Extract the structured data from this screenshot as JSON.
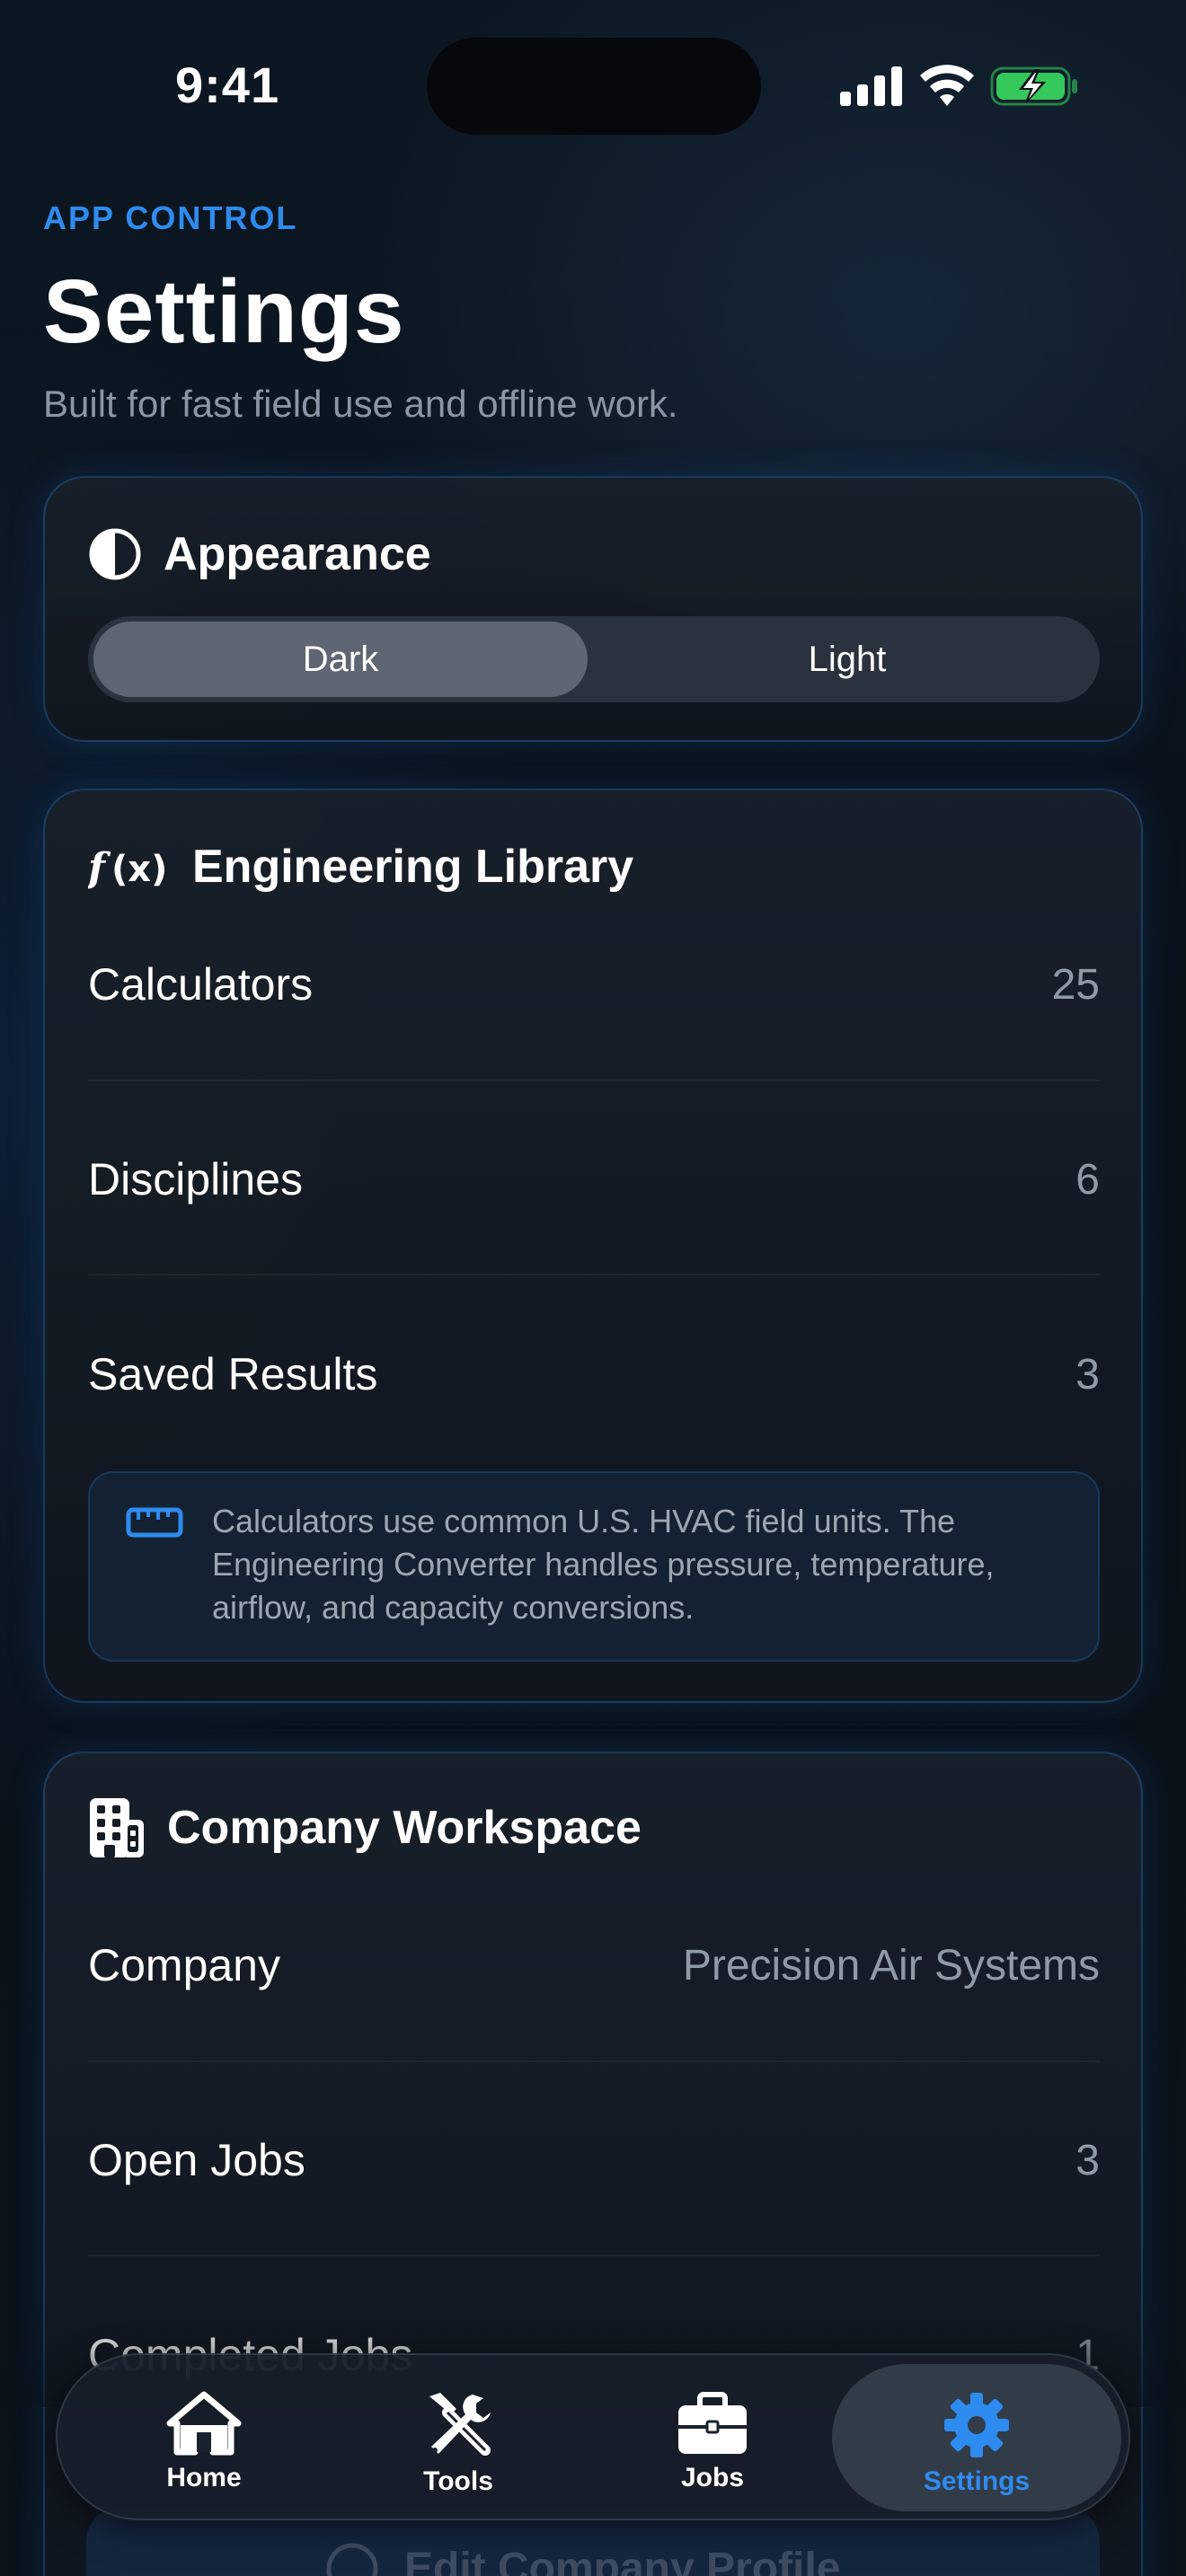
{
  "status_bar": {
    "time": "9:41"
  },
  "header": {
    "eyebrow": "APP CONTROL",
    "title": "Settings",
    "subtitle": "Built for fast field use and offline work."
  },
  "appearance": {
    "title": "Appearance",
    "icon": "contrast-icon",
    "options": [
      "Dark",
      "Light"
    ],
    "selected": "Dark"
  },
  "library": {
    "title": "Engineering Library",
    "icon": "function-icon",
    "rows": [
      {
        "label": "Calculators",
        "value": "25"
      },
      {
        "label": "Disciplines",
        "value": "6"
      },
      {
        "label": "Saved Results",
        "value": "3"
      }
    ],
    "info": "Calculators use common U.S. HVAC field units. The Engineering Converter handles pressure, temperature, airflow, and capacity conversions.",
    "info_icon": "ruler-icon"
  },
  "company": {
    "title": "Company Workspace",
    "icon": "building-icon",
    "rows": [
      {
        "label": "Company",
        "value": "Precision Air Systems"
      },
      {
        "label": "Open Jobs",
        "value": "3"
      },
      {
        "label": "Completed Jobs",
        "value": "1"
      }
    ],
    "edit_button": "Edit Company Profile"
  },
  "tabbar": {
    "tabs": [
      {
        "label": "Home",
        "icon": "house-icon"
      },
      {
        "label": "Tools",
        "icon": "tools-icon"
      },
      {
        "label": "Jobs",
        "icon": "briefcase-icon"
      },
      {
        "label": "Settings",
        "icon": "gear-icon"
      }
    ],
    "active": "Settings"
  },
  "colors": {
    "accent": "#2E8BEF",
    "background": "#0B121A",
    "card": "#141C25",
    "battery": "#34C759"
  }
}
